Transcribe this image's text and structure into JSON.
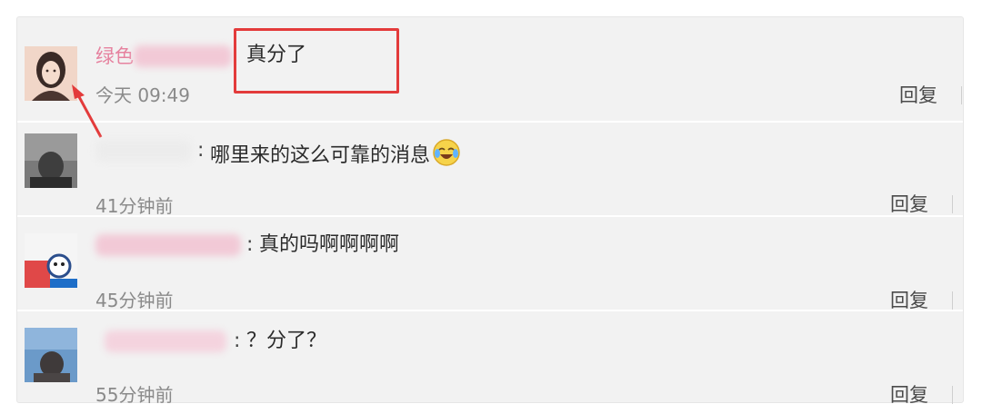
{
  "comments": [
    {
      "name_visible": "绿色",
      "content": "真分了",
      "time": "今天 09:49",
      "reply_label": "回复"
    },
    {
      "separator": ":",
      "content": "哪里来的这么可靠的消息",
      "emoji": "laughing-crying-emoji",
      "time": "41分钟前",
      "reply_label": "回复"
    },
    {
      "separator": ":",
      "content": "真的吗啊啊啊啊",
      "time": "45分钟前",
      "reply_label": "回复"
    },
    {
      "separator": ":",
      "content": "？分了？",
      "time": "55分钟前",
      "reply_label": "回复"
    }
  ],
  "colors": {
    "panel_bg": "#f2f2f2",
    "name_pink": "#e6829f",
    "highlight_red": "#e33b3b",
    "time_gray": "#8a8a8a"
  }
}
